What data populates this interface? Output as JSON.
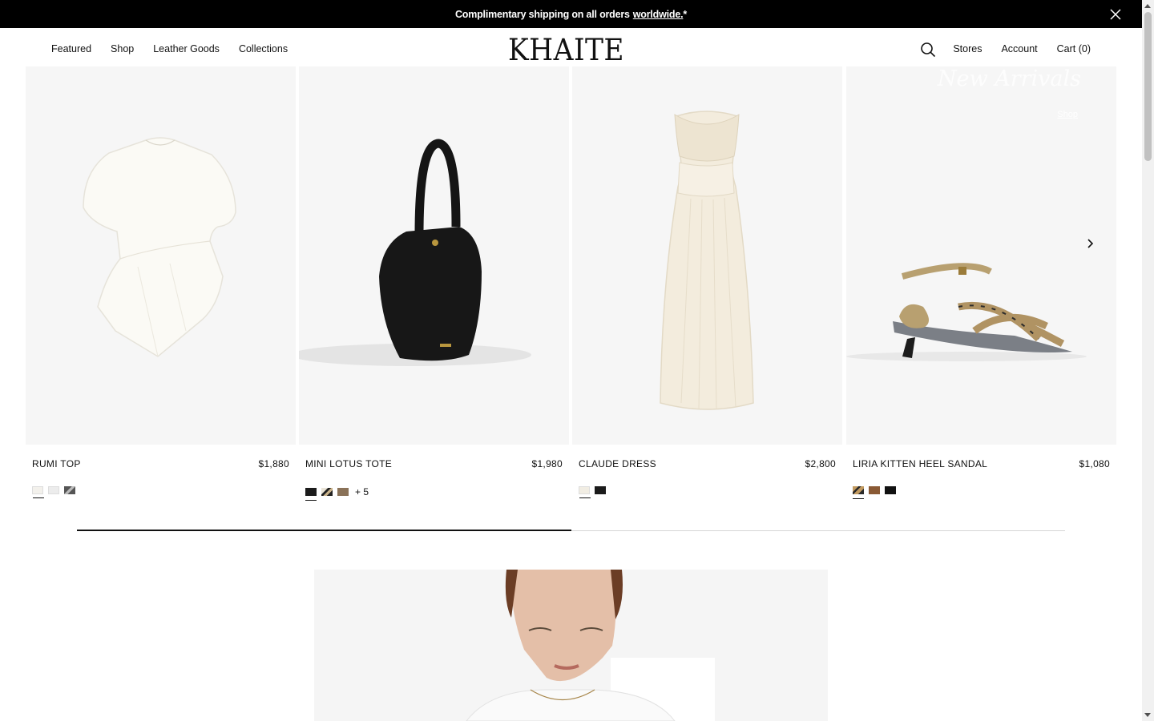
{
  "announcement": {
    "text": "Complimentary shipping on all orders",
    "link": "worldwide.",
    "suffix": "*"
  },
  "header": {
    "logo": "KHAITE",
    "nav_left": [
      "Featured",
      "Shop",
      "Leather Goods",
      "Collections"
    ],
    "nav_right": {
      "stores": "Stores",
      "account": "Account",
      "cart": "Cart (0)"
    }
  },
  "carousel": {
    "overlay_title": "New Arrivals",
    "overlay_link": "Shop",
    "progress_fraction": 0.5,
    "products": [
      {
        "name": "RUMI TOP",
        "price": "$1,880",
        "swatches": [
          "#f3f1ec",
          "#ececec",
          "pattern-grey"
        ],
        "more": ""
      },
      {
        "name": "MINI LOTUS TOTE",
        "price": "$1,980",
        "swatches": [
          "#1b1b1b",
          "pattern-print",
          "#8a7258"
        ],
        "more": "+ 5"
      },
      {
        "name": "CLAUDE DRESS",
        "price": "$2,800",
        "swatches": [
          "#f1ede3",
          "#1b1b1b"
        ],
        "more": ""
      },
      {
        "name": "LIRIA KITTEN HEEL SANDAL",
        "price": "$1,080",
        "swatches": [
          "pattern-snake",
          "#8a5a35",
          "#111111"
        ],
        "more": ""
      }
    ]
  },
  "icons": {
    "close": "close-icon",
    "search": "search-icon",
    "next": "chevron-right-icon"
  }
}
